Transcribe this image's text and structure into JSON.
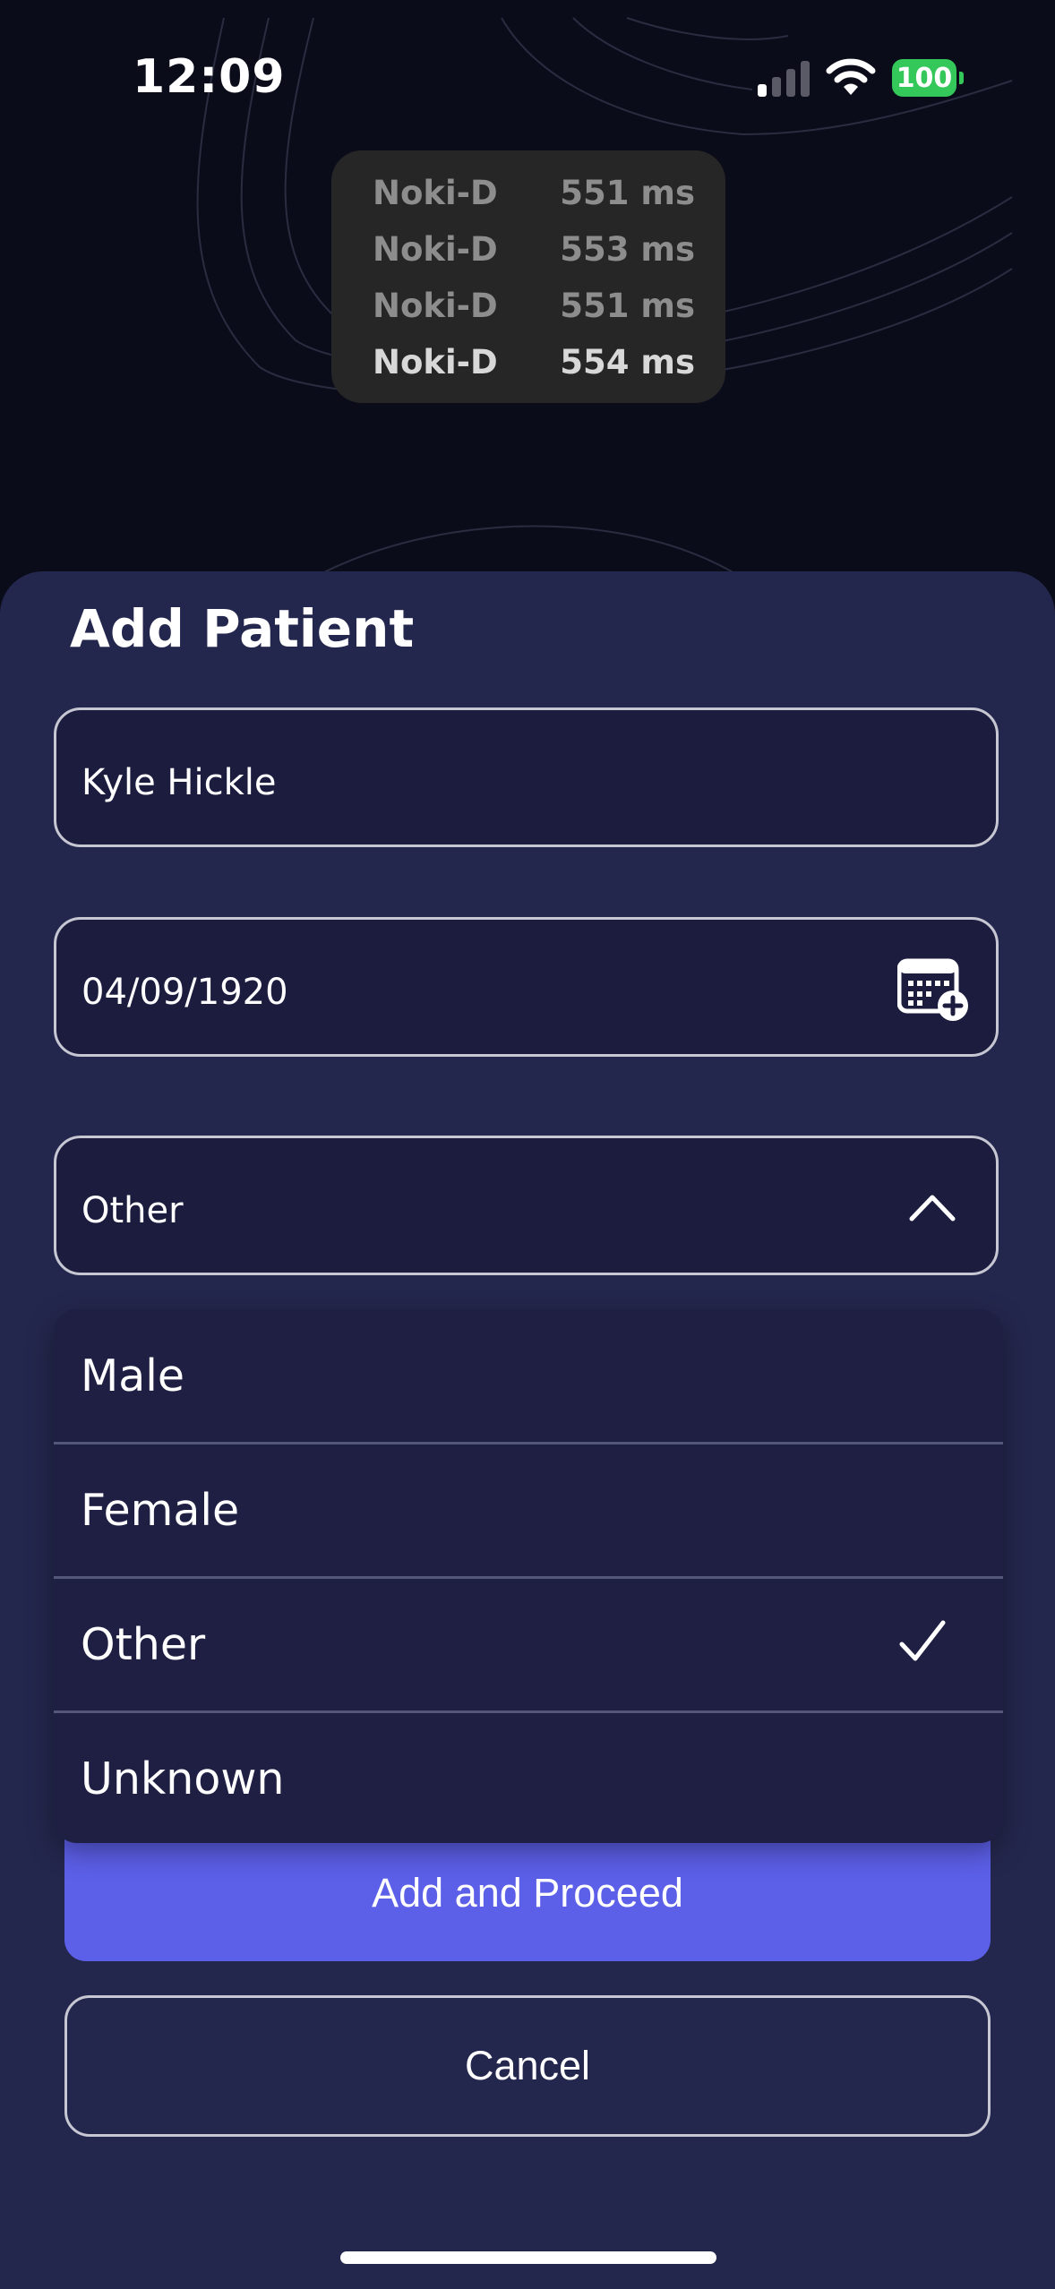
{
  "status_bar": {
    "time": "12:09",
    "battery_level": "100",
    "battery_color": "#34c759"
  },
  "latency": {
    "rows": [
      {
        "name": "Noki-D",
        "value": "551 ms"
      },
      {
        "name": "Noki-D",
        "value": "553 ms"
      },
      {
        "name": "Noki-D",
        "value": "551 ms"
      },
      {
        "name": "Noki-D",
        "value": "554 ms"
      }
    ]
  },
  "form": {
    "title": "Add Patient",
    "name_value": "Kyle Hickle",
    "dob_value": "04/09/1920",
    "gender_value": "Other",
    "calendar_icon": "calendar-add-icon",
    "chevron_icon": "chevron-up-icon"
  },
  "gender_options": [
    {
      "label": "Male",
      "selected": false
    },
    {
      "label": "Female",
      "selected": false
    },
    {
      "label": "Other",
      "selected": true
    },
    {
      "label": "Unknown",
      "selected": false
    }
  ],
  "buttons": {
    "primary": "Add and Proceed",
    "secondary": "Cancel"
  },
  "colors": {
    "sheet_bg": "#24274d",
    "accent": "#5c5fe8",
    "field_bg": "#1b1c3e"
  }
}
